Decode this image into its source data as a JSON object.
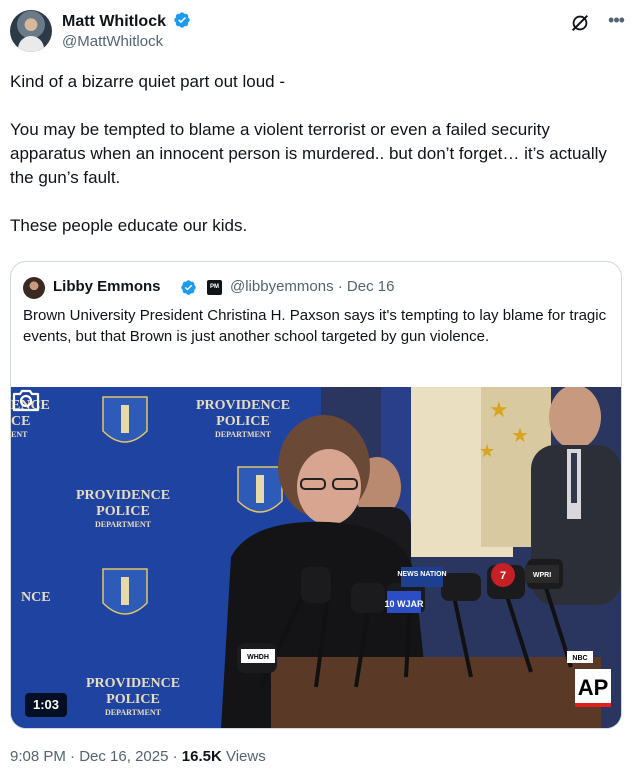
{
  "author": {
    "name": "Matt Whitlock",
    "handle": "@MattWhitlock"
  },
  "post": {
    "paragraphs": [
      "Kind of a bizarre quiet part out loud -",
      "You may be tempted to blame a violent terrorist or even a failed security apparatus when an innocent person is murdered..  but don’t forget…  it’s actually the gun’s fault.",
      "These people educate our kids."
    ]
  },
  "quote": {
    "name": "Libby Emmons",
    "badge": "PM",
    "handle_date": "@libbyemmons · Dec 16",
    "text": "Brown University President Christina H. Paxson says it's tempting to lay blame for tragic events, but that Brown is just another school targeted by gun violence.",
    "video": {
      "duration": "1:03",
      "backdrop_text": [
        "PROVIDENCE",
        "POLICE",
        "DEPARTMENT"
      ],
      "backdrop_partial_left": [
        "ENCE",
        "CE",
        "ENT"
      ],
      "backdrop_partial_left_lower": "NCE",
      "mic_labels": [
        "NEWS NATION",
        "10 WJAR",
        "7",
        "WPRI",
        "WHDH",
        "NBC"
      ],
      "watermark": "AP",
      "backdrop_color": "#1d3f8f"
    }
  },
  "meta": {
    "time": "9:08 PM",
    "separator": " · ",
    "date": "Dec 16, 2025",
    "views_count": "16.5K",
    "views_label": " Views"
  },
  "colors": {
    "verified": "#1d9bf0",
    "secondary_text": "#536471",
    "primary_text": "#0f1419",
    "border": "#cfd9de"
  },
  "icons": {
    "grok": "grok-icon",
    "more": "more-icon",
    "camera": "camera-icon",
    "verified": "verified-badge-icon"
  }
}
